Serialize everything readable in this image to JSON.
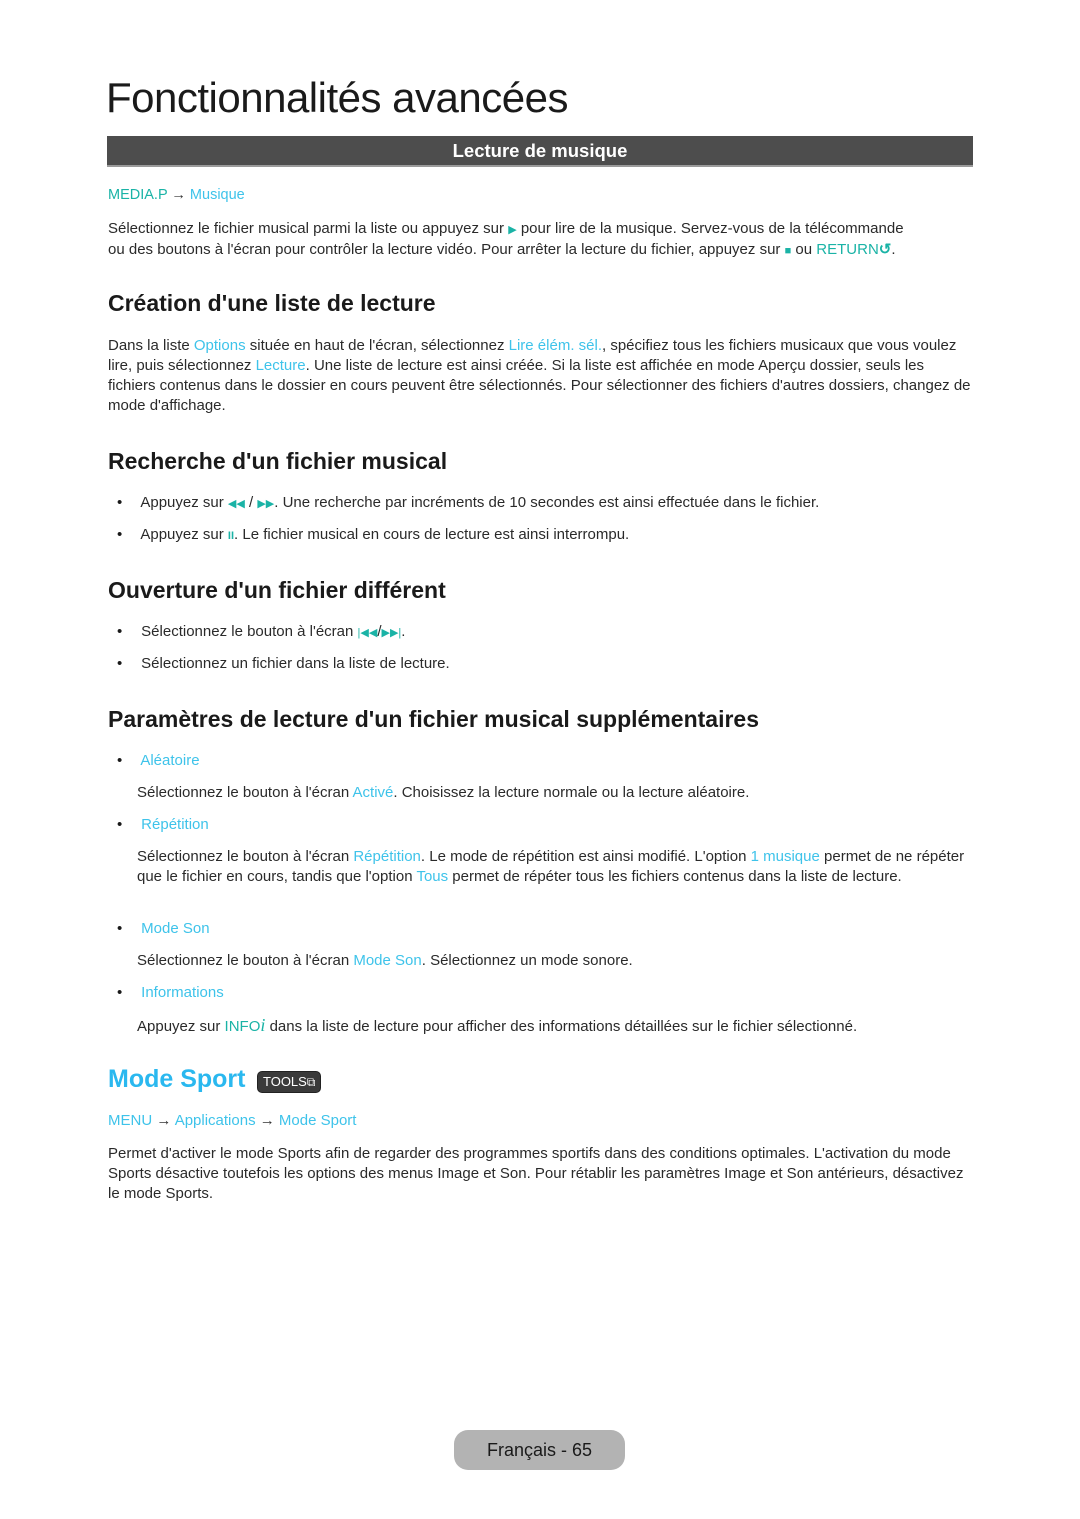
{
  "page": {
    "title": "Fonctionnalités avancées",
    "section_bar": "Lecture de musique",
    "footer": "Français - 65"
  },
  "lecture": {
    "path": {
      "key": "MEDIA.P",
      "arrow": "→",
      "item": "Musique"
    },
    "p1": "Sélectionnez le fichier musical parmi la liste ou appuyez sur",
    "p1_icon": "play-icon",
    "p2": "pour lire de la musique. Servez-vous de la télécommande",
    "p3": "ou des boutons à l'écran pour contrôler la lecture vidéo. Pour arrêter la lecture du fichier, appuyez sur",
    "p3_icon": "stop-icon",
    "p4": "ou",
    "return_key": "RETURN",
    "return_icon": "return-icon",
    "p5": "."
  },
  "creation": {
    "heading": "Création d'une liste de lecture",
    "t1": "Dans la liste ",
    "options": "Options",
    "t2": " située en haut de l'écran, sélectionnez ",
    "lire": "Lire élém. sél.",
    "t3": ", spécifiez tous les fichiers musicaux que vous voulez lire, puis sélectionnez ",
    "lecture": "Lecture",
    "t4": ". Une liste de lecture est ainsi créée. Si la liste est affichée en mode Aperçu dossier, seuls les fichiers contenus dans le dossier en cours peuvent être sélectionnés. Pour sélectionner des fichiers d'autres dossiers, changez de mode d'affichage."
  },
  "recherche": {
    "heading": "Recherche d'un fichier musical",
    "b1_a": "Appuyez sur",
    "b1_icon1": "rewind-icon",
    "b1_sep": "/",
    "b1_icon2": "fast-forward-icon",
    "b1_b": ". Une recherche par incréments de 10 secondes est ainsi effectuée dans le fichier.",
    "b2_a": "Appuyez sur",
    "b2_icon": "pause-icon",
    "b2_b": ". Le fichier musical en cours de lecture est ainsi interrompu."
  },
  "ouverture": {
    "heading": "Ouverture d'un fichier différent",
    "b1_a": "Sélectionnez le bouton à l'écran",
    "b1_icon1": "skip-previous-icon",
    "b1_sep": "/",
    "b1_icon2": "skip-next-icon",
    "b1_b": ".",
    "b2": "Sélectionnez un fichier dans la liste de lecture."
  },
  "parametres": {
    "heading": "Paramètres de lecture d'un fichier musical supplémentaires",
    "aleatoire": {
      "label": "Aléatoire",
      "t1": "Sélectionnez le bouton à l'écran ",
      "term": "Activé",
      "t2": ". Choisissez la lecture normale ou la lecture aléatoire."
    },
    "repetition": {
      "label": "Répétition",
      "t1": "Sélectionnez le bouton à l'écran ",
      "term": "Répétition",
      "t2": ". Le mode de répétition est ainsi modifié. L'option ",
      "term2": "1 musique",
      "t3": " permet de ne répéter que le fichier en cours, tandis que l'option ",
      "term3": "Tous",
      "t4": " permet de répéter tous les fichiers contenus dans la liste de lecture."
    },
    "mode_son": {
      "label": "Mode Son",
      "t1": "Sélectionnez le bouton à l'écran ",
      "term": "Mode Son",
      "t2": ". Sélectionnez un mode sonore."
    },
    "informations": {
      "label": "Informations",
      "t1": "Appuyez sur ",
      "key": "INFO",
      "key_icon": "info-icon",
      "t2": " dans la liste de lecture pour afficher des informations détaillées sur le fichier sélectionné."
    }
  },
  "mode_sport": {
    "heading": "Mode Sport",
    "tools_badge": "TOOLS",
    "path": {
      "menu": "MENU",
      "arrow": "→",
      "apps": "Applications",
      "item": "Mode Sport"
    },
    "body": "Permet d'activer le mode Sports afin de regarder des programmes sportifs dans des conditions optimales. L'activation du mode Sports désactive toutefois les options des menus Image et Son. Pour rétablir les paramètres Image et Son antérieurs, désactivez le mode Sports."
  },
  "colors": {
    "remote_key": "#1ab3a6",
    "menu_term": "#3ec3ea",
    "heading_accent": "#2ab8ef",
    "section_bar": "#4d4d4d"
  }
}
